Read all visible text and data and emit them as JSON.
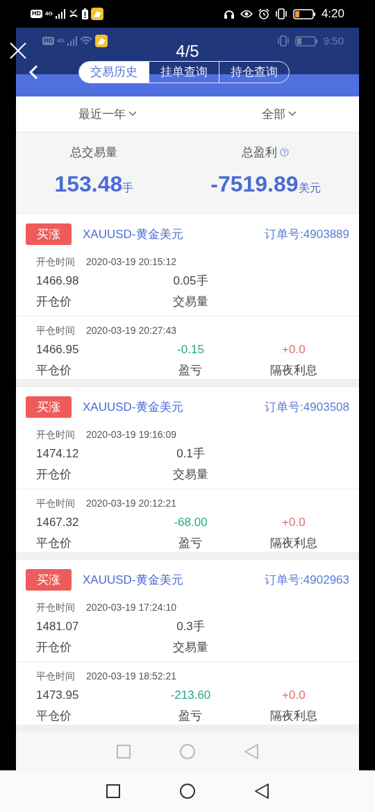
{
  "outer_status": {
    "network": "HD",
    "generation": "4G",
    "time": "4:20"
  },
  "viewer": {
    "counter": "4/5"
  },
  "inner_status": {
    "network": "HD",
    "generation": "4G",
    "time": "9:50"
  },
  "tabs": [
    {
      "label": "交易历史",
      "selected": true
    },
    {
      "label": "挂单查询",
      "selected": false
    },
    {
      "label": "持仓查询",
      "selected": false
    }
  ],
  "filters": [
    {
      "label": "最近一年"
    },
    {
      "label": "全部"
    }
  ],
  "summary": [
    {
      "label": "总交易量",
      "value": "153.48",
      "unit": "手",
      "help": false
    },
    {
      "label": "总盈利",
      "value": "-7519.89",
      "unit": "美元",
      "help": true
    }
  ],
  "orders": [
    {
      "side": "买涨",
      "symbol": "XAUUSD-黄金美元",
      "order_no": "订单号:4903889",
      "open_time_label": "开仓时间",
      "open_time": "2020-03-19 20:15:12",
      "open_price": "1466.98",
      "volume": "0.05手",
      "open_price_label": "开仓价",
      "volume_label": "交易量",
      "close_time_label": "平仓时间",
      "close_time": "2020-03-19 20:27:43",
      "close_price": "1466.95",
      "profit": "-0.15",
      "swap": "+0.0",
      "close_price_label": "平仓价",
      "profit_label": "盈亏",
      "swap_label": "隔夜利息"
    },
    {
      "side": "买涨",
      "symbol": "XAUUSD-黄金美元",
      "order_no": "订单号:4903508",
      "open_time_label": "开仓时间",
      "open_time": "2020-03-19 19:16:09",
      "open_price": "1474.12",
      "volume": "0.1手",
      "open_price_label": "开仓价",
      "volume_label": "交易量",
      "close_time_label": "平仓时间",
      "close_time": "2020-03-19 20:12:21",
      "close_price": "1467.32",
      "profit": "-68.00",
      "swap": "+0.0",
      "close_price_label": "平仓价",
      "profit_label": "盈亏",
      "swap_label": "隔夜利息"
    },
    {
      "side": "买涨",
      "symbol": "XAUUSD-黄金美元",
      "order_no": "订单号:4902963",
      "open_time_label": "开仓时间",
      "open_time": "2020-03-19 17:24:10",
      "open_price": "1481.07",
      "volume": "0.3手",
      "open_price_label": "开仓价",
      "volume_label": "交易量",
      "close_time_label": "平仓时间",
      "close_time": "2020-03-19 18:52:21",
      "close_price": "1473.95",
      "profit": "-213.60",
      "swap": "+0.0",
      "close_price_label": "平仓价",
      "profit_label": "盈亏",
      "swap_label": "隔夜利息"
    }
  ]
}
